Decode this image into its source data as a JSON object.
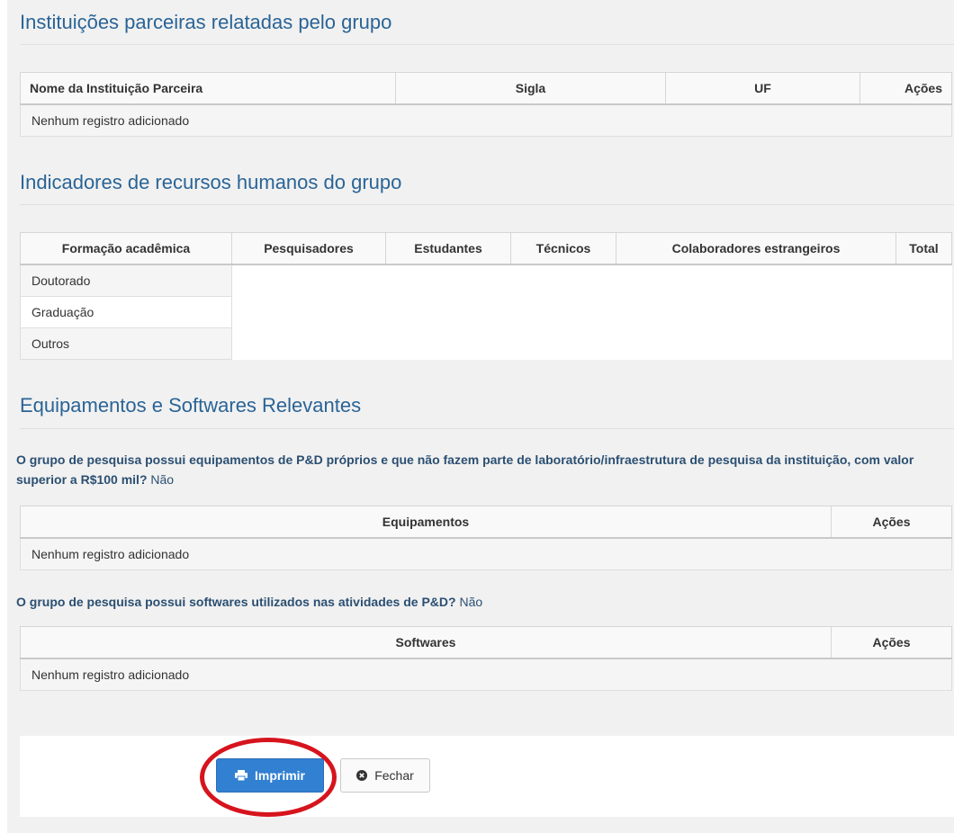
{
  "sections": {
    "partners": {
      "title": "Instituições parceiras relatadas pelo grupo",
      "columns": [
        "Nome da Instituição Parceira",
        "Sigla",
        "UF",
        "Ações"
      ],
      "empty_message": "Nenhum registro adicionado"
    },
    "hr": {
      "title": "Indicadores de recursos humanos do grupo",
      "columns": [
        "Formação acadêmica",
        "Pesquisadores",
        "Estudantes",
        "Técnicos",
        "Colaboradores estrangeiros",
        "Total"
      ],
      "rows": [
        "Doutorado",
        "Graduação",
        "Outros"
      ]
    },
    "equipment": {
      "title": "Equipamentos e Softwares Relevantes",
      "equip_question": "O grupo de pesquisa possui equipamentos de P&D próprios e que não fazem parte de laboratório/infraestrutura de pesquisa da instituição, com valor superior a R$100 mil?",
      "equip_answer": "Não",
      "equip_columns": [
        "Equipamentos",
        "Ações"
      ],
      "equip_empty": "Nenhum registro adicionado",
      "soft_question": "O grupo de pesquisa possui softwares utilizados nas atividades de P&D?",
      "soft_answer": "Não",
      "soft_columns": [
        "Softwares",
        "Ações"
      ],
      "soft_empty": "Nenhum registro adicionado"
    }
  },
  "footer": {
    "print_label": "Imprimir",
    "close_label": "Fechar",
    "print_icon": "printer-icon",
    "close_icon": "close-circle-icon"
  },
  "colors": {
    "section_title": "#2a6496",
    "question_text": "#2b4f72",
    "primary_button": "#3280d1",
    "highlight_ring": "#d6141d"
  }
}
